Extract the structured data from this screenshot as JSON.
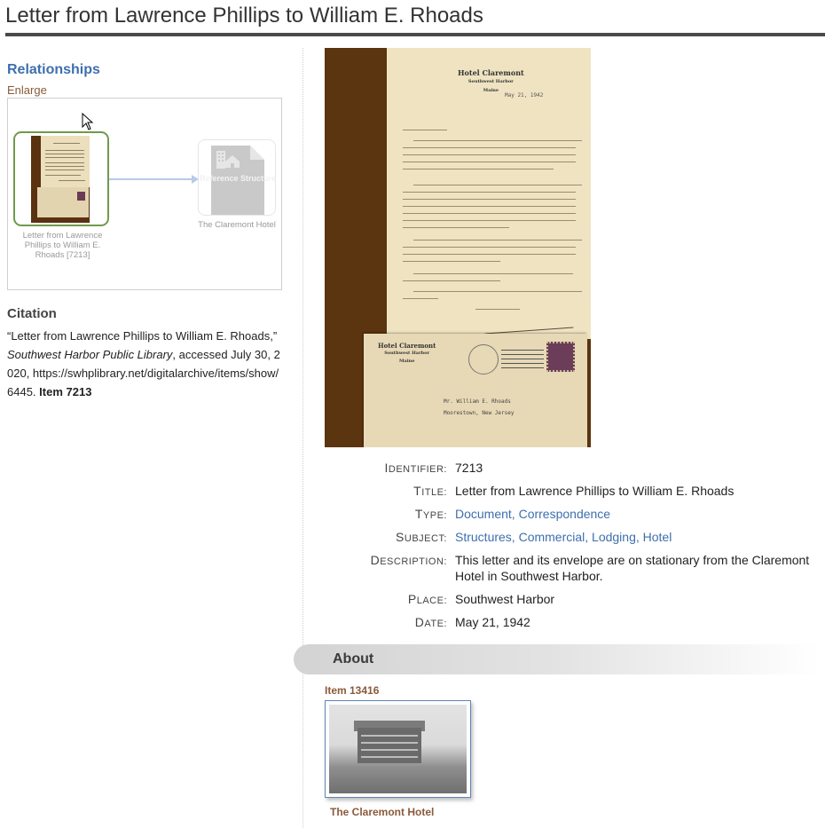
{
  "page": {
    "title": "Letter from Lawrence Phillips to William E. Rhoads"
  },
  "relationships": {
    "heading": "Relationships",
    "enlarge_link": "Enlarge",
    "main_node_label": "Letter from Lawrence Phillips to William E. Rhoads [7213]",
    "ref_node_text": "Reference Structure",
    "ref_node_label": "The Claremont Hotel"
  },
  "citation": {
    "heading": "Citation",
    "quote": "“Letter from Lawrence Phillips to William E. Rhoads,” ",
    "publisher": "Southwest Harbor Public Library",
    "accessed": ", accessed July 30, 2020, https://swhplibrary.net/digitalarchive/items/show/6445. ",
    "item": "Item 7213"
  },
  "letter_image": {
    "hotel_name": "Hotel Claremont",
    "hotel_place": "Southwest Harbor",
    "hotel_state": "Maine",
    "date": "May 21, 1942",
    "envelope_addressee": "Mr. William E. Rhoads",
    "envelope_city": "Moorestown, New Jersey"
  },
  "metadata": [
    {
      "label": "Identifier:",
      "value": "7213",
      "link": false
    },
    {
      "label": "Title:",
      "value": "Letter from Lawrence Phillips to William E. Rhoads",
      "link": false
    },
    {
      "label": "Type:",
      "value": "Document, Correspondence",
      "link": true
    },
    {
      "label": "Subject:",
      "value": "Structures, Commercial, Lodging, Hotel",
      "link": true
    },
    {
      "label": "Description:",
      "value": "This letter and its envelope are on stationary from the Claremont Hotel in Southwest Harbor.",
      "link": false
    },
    {
      "label": "Place:",
      "value": "Southwest Harbor",
      "link": false
    },
    {
      "label": "Date:",
      "value": "May 21, 1942",
      "link": false
    }
  ],
  "about": {
    "heading": "About",
    "item_label": "Item 13416",
    "item_name": "The Claremont Hotel"
  }
}
